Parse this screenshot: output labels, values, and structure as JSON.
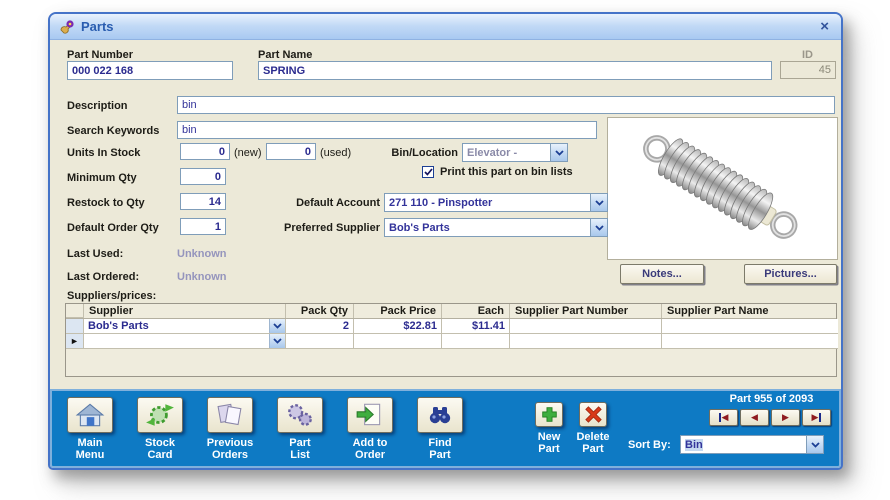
{
  "window": {
    "title": "Parts",
    "close_glyph": "×"
  },
  "header": {
    "part_number_label": "Part Number",
    "part_number": "000 022 168",
    "part_name_label": "Part Name",
    "part_name": "SPRING",
    "id_label": "ID",
    "id_value": "45"
  },
  "fields": {
    "description_label": "Description",
    "description": "bin",
    "search_keywords_label": "Search Keywords",
    "search_keywords": "bin",
    "units_in_stock_label": "Units In Stock",
    "units_new": "0",
    "units_new_suffix": "(new)",
    "units_used": "0",
    "units_used_suffix": "(used)",
    "bin_location_label": "Bin/Location",
    "bin_location": "Elevator -",
    "print_bin_label": "Print this part on bin lists",
    "print_bin_checked": true,
    "minimum_qty_label": "Minimum Qty",
    "minimum_qty": "0",
    "restock_label": "Restock to Qty",
    "restock": "14",
    "default_account_label": "Default Account",
    "default_account": "271 110 - Pinspotter",
    "default_order_qty_label": "Default Order Qty",
    "default_order_qty": "1",
    "preferred_supplier_label": "Preferred Supplier",
    "preferred_supplier": "Bob's Parts",
    "last_used_label": "Last Used:",
    "last_used": "Unknown",
    "last_ordered_label": "Last Ordered:",
    "last_ordered": "Unknown"
  },
  "image_panel": {
    "notes_button": "Notes...",
    "pictures_button": "Pictures..."
  },
  "suppliers": {
    "section_label": "Suppliers/prices:",
    "headers": [
      "Supplier",
      "Pack Qty",
      "Pack Price",
      "Each",
      "Supplier Part Number",
      "Supplier Part Name"
    ],
    "rows": [
      {
        "supplier": "Bob's Parts",
        "pack_qty": "2",
        "pack_price": "$22.81",
        "each": "$11.41",
        "supplier_part_number": "",
        "supplier_part_name": ""
      }
    ],
    "new_row_marker": "►"
  },
  "toolbar": {
    "buttons": [
      {
        "label1": "Main",
        "label2": "Menu",
        "icon": "house-icon"
      },
      {
        "label1": "Stock",
        "label2": "Card",
        "icon": "stock-gears-icon"
      },
      {
        "label1": "Previous",
        "label2": "Orders",
        "icon": "documents-icon"
      },
      {
        "label1": "Part",
        "label2": "List",
        "icon": "gears-icon"
      },
      {
        "label1": "Add to",
        "label2": "Order",
        "icon": "add-document-icon"
      },
      {
        "label1": "Find",
        "label2": "Part",
        "icon": "binoculars-icon"
      }
    ],
    "new_part": {
      "label1": "New",
      "label2": "Part",
      "icon": "green-plus-icon"
    },
    "delete_part": {
      "label1": "Delete",
      "label2": "Part",
      "icon": "red-x-icon"
    },
    "record_position": "Part 955 of 2093",
    "nav": {
      "first_glyph": "◀",
      "prev_glyph": "◀",
      "next_glyph": "▶",
      "last_glyph": "▶"
    },
    "sort_by_label": "Sort By:",
    "sort_by_value": "Bin"
  },
  "colors": {
    "toolbar_blue": "#0e7ac4",
    "window_border": "#4573c8",
    "title_text": "#2a5db0",
    "value_navy": "#2b2b8f",
    "content_bg": "#ece9d8",
    "nav_arrow_red": "#8f1b20"
  }
}
